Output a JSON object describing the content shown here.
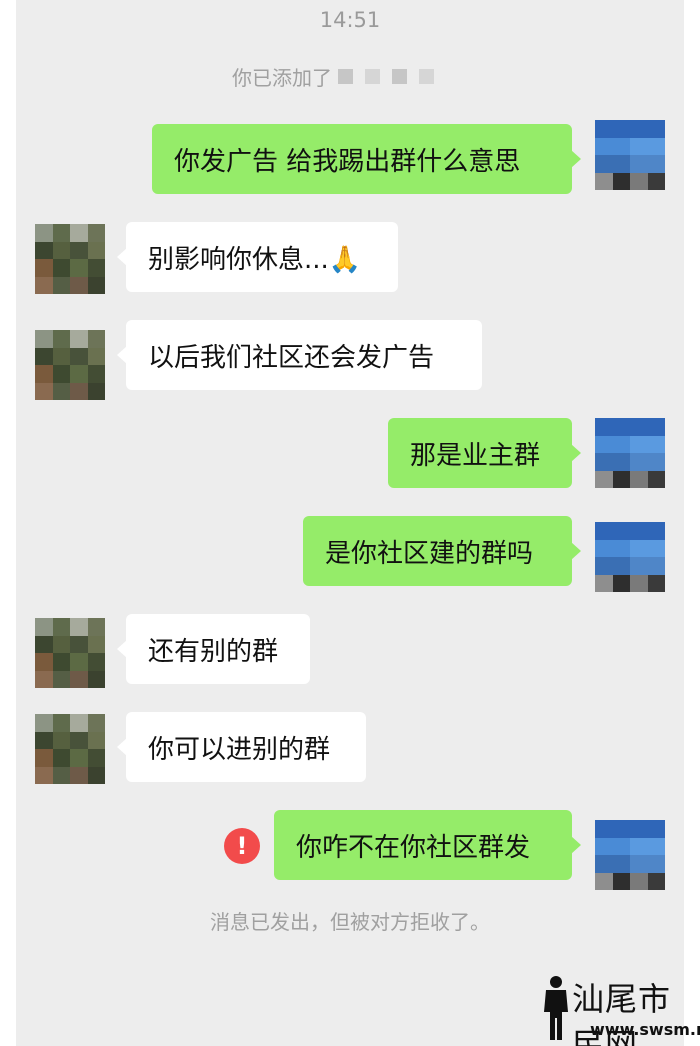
{
  "status": {
    "time": "14:51"
  },
  "system": {
    "added_prefix": "你已添加了"
  },
  "messages": [
    {
      "side": "out",
      "text": "你发广告 给我踢出群什么意思"
    },
    {
      "side": "in",
      "text": "别影响你休息...🙏"
    },
    {
      "side": "in",
      "text": "以后我们社区还会发广告"
    },
    {
      "side": "out",
      "text": "那是业主群"
    },
    {
      "side": "out",
      "text": "是你社区建的群吗"
    },
    {
      "side": "in",
      "text": "还有别的群"
    },
    {
      "side": "in",
      "text": "你可以进别的群"
    },
    {
      "side": "out",
      "text": "你咋不在你社区群发",
      "failed": true
    }
  ],
  "error": {
    "icon": "!"
  },
  "notice": "消息已发出，但被对方拒收了。",
  "watermark": {
    "title": "汕尾市民网",
    "url": "www.swsm.net"
  },
  "colors": {
    "out_bubble": "#95ec69",
    "in_bubble": "#ffffff",
    "chat_bg": "#ededed",
    "error": "#f24b4b"
  }
}
